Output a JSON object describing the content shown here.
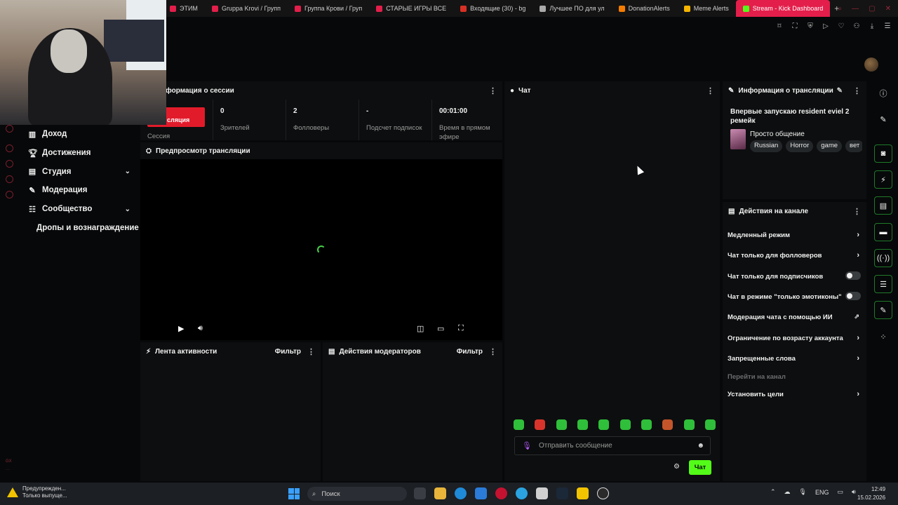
{
  "browser": {
    "tabs": [
      {
        "label": "ЭТИМ",
        "color": "#e31e4a"
      },
      {
        "label": "Gruppa Krovi / Групп",
        "color": "#e31e4a"
      },
      {
        "label": "Группа Крови / Груп",
        "color": "#e31e4a"
      },
      {
        "label": "СТАРЫЕ ИГРЫ ВСЕ",
        "color": "#e31e4a"
      },
      {
        "label": "Входящие (30) - bg",
        "color": "#d93025"
      },
      {
        "label": "Лучшее ПО для ул",
        "color": "#aaaaaa"
      },
      {
        "label": "DonationAlerts",
        "color": "#f57c00"
      },
      {
        "label": "Meme Alerts",
        "color": "#f5b400"
      },
      {
        "label": "Stream - Kick Dashboard",
        "color": "#53fc18"
      }
    ],
    "new_tab": "+"
  },
  "sidebar": {
    "items": [
      {
        "label": "Доход",
        "icon": "chart-icon"
      },
      {
        "label": "Достижения",
        "icon": "trophy-icon"
      },
      {
        "label": "Студия",
        "icon": "studio-icon",
        "chevron": "⌄"
      },
      {
        "label": "Модерация",
        "icon": "wrench-icon"
      },
      {
        "label": "Сообщество",
        "icon": "community-icon",
        "chevron": "⌄"
      },
      {
        "label": "Дропы и вознаграждение"
      }
    ]
  },
  "session": {
    "title": "формация о сессии",
    "live_label": "сляция",
    "session_label": "Сессия",
    "stats": [
      {
        "value": "0",
        "label": "Зрителей"
      },
      {
        "value": "2",
        "label": "Фолловеры"
      },
      {
        "value": "-",
        "label": "Подсчет подписок"
      },
      {
        "value": "00:01:00",
        "label": "Время в прямом эфире"
      }
    ]
  },
  "preview": {
    "title": "Предпросмотр трансляции"
  },
  "activity": {
    "title": "Лента активности",
    "filter": "Фильтр"
  },
  "modactions": {
    "title": "Действия модераторов",
    "filter": "Фильтр"
  },
  "chat": {
    "title": "Чат",
    "input_placeholder": "Отправить сообщение",
    "send_label": "Чат",
    "emote_colors": [
      "#2fbf3a",
      "#d9342b",
      "#2fbf3a",
      "#2fbf3a",
      "#2fbf3a",
      "#2fbf3a",
      "#2fbf3a",
      "#c4552a",
      "#2fbf3a",
      "#2fbf3a"
    ]
  },
  "stream_info": {
    "title": "Информация о трансляции",
    "stream_title": "Впервые запускаю resident eviel 2 ремейк",
    "category": "Просто общение",
    "tags": [
      "Russian",
      "Horror",
      "game",
      "вет"
    ]
  },
  "channel_actions": {
    "title": "Действия на канале",
    "items": [
      {
        "label": "Медленный режим",
        "control": "chevron"
      },
      {
        "label": "Чат только для фолловеров",
        "control": "chevron"
      },
      {
        "label": "Чат только для подписчиков",
        "control": "toggle",
        "on": false
      },
      {
        "label": "Чат в режиме \"только эмотиконы\"",
        "control": "toggle",
        "on": false
      },
      {
        "label": "Модерация чата с помощью ИИ",
        "control": "external"
      },
      {
        "label": "Ограничение по возрасту аккаунта",
        "control": "chevron"
      },
      {
        "label": "Запрещенные слова",
        "control": "chevron"
      },
      {
        "label": "Перейти на канал",
        "control": "none",
        "muted": true
      },
      {
        "label": "Установить цели",
        "control": "chevron"
      }
    ]
  },
  "taskbar": {
    "warning_line1": "Предупрежден...",
    "warning_line2": "Только выпуще...",
    "search_placeholder": "Поиск",
    "language": "ENG",
    "time": "12:49",
    "date": "15.02.2026"
  },
  "colors": {
    "accent": "#53fc18",
    "live": "#e21b2b",
    "active_tab": "#e31e4a"
  }
}
